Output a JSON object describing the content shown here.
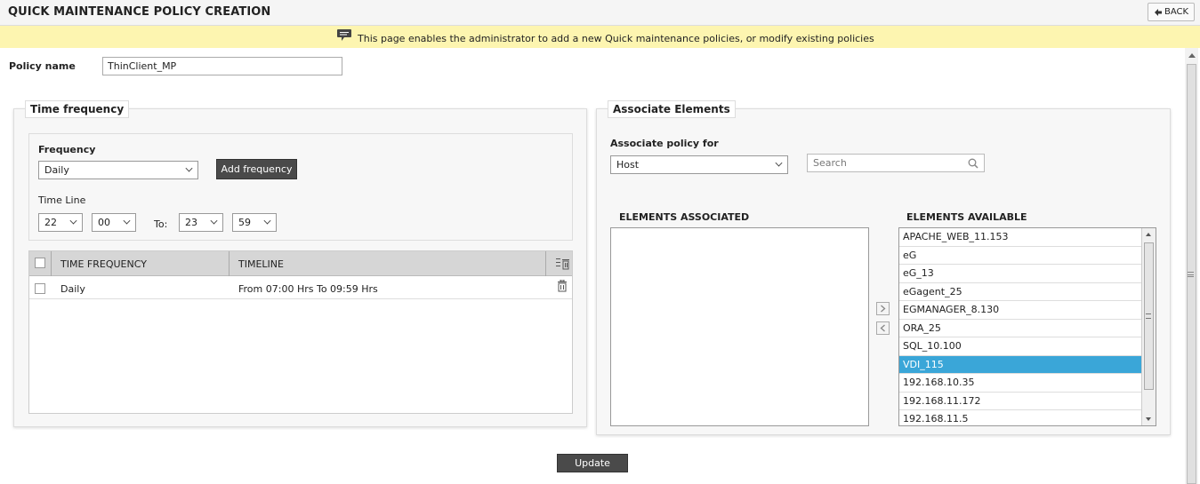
{
  "header": {
    "title": "QUICK MAINTENANCE POLICY CREATION",
    "back_label": "BACK"
  },
  "info": {
    "message": "This page enables the administrator to add a new Quick maintenance policies, or modify existing policies"
  },
  "policy": {
    "label": "Policy name",
    "value": "ThinClient_MP"
  },
  "time_frequency": {
    "legend": "Time frequency",
    "frequency_label": "Frequency",
    "frequency_value": "Daily",
    "add_button": "Add frequency",
    "timeline_label": "Time Line",
    "from_hour": "22",
    "from_min": "00",
    "to_label": "To:",
    "to_hour": "23",
    "to_min": "59",
    "table": {
      "headers": {
        "frequency": "TIME FREQUENCY",
        "timeline": "TIMELINE"
      },
      "rows": [
        {
          "frequency": "Daily",
          "timeline": "From 07:00 Hrs To 09:59 Hrs"
        }
      ]
    }
  },
  "associate": {
    "legend": "Associate Elements",
    "policy_for_label": "Associate policy for",
    "policy_for_value": "Host",
    "search_placeholder": "Search",
    "associated_header": "ELEMENTS ASSOCIATED",
    "available_header": "ELEMENTS AVAILABLE",
    "available_items": [
      "APACHE_WEB_11.153",
      "eG",
      "eG_13",
      "eGagent_25",
      "EGMANAGER_8.130",
      "ORA_25",
      "SQL_10.100",
      "VDI_115",
      "192.168.10.35",
      "192.168.11.172",
      "192.168.11.5"
    ],
    "selected_item": "VDI_115"
  },
  "footer": {
    "update_label": "Update"
  },
  "colors": {
    "info_bg": "#fdf5b0",
    "selected": "#3aa6d8",
    "dark_button": "#4a4a4a"
  }
}
